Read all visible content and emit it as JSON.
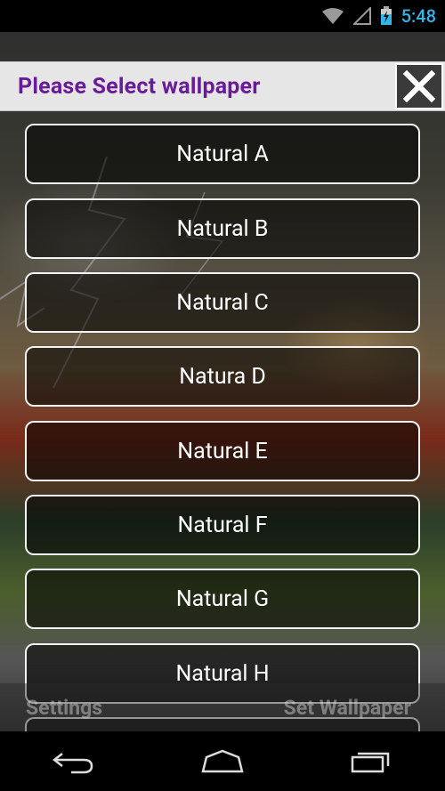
{
  "status_bar": {
    "time": "5:48",
    "icons": [
      "wifi-icon",
      "signal-icon",
      "battery-icon"
    ]
  },
  "dialog": {
    "title": "Please Select wallpaper",
    "close_icon": "close-icon"
  },
  "wallpapers": [
    {
      "label": "Natural A"
    },
    {
      "label": "Natural B"
    },
    {
      "label": "Natural C"
    },
    {
      "label": "Natura D"
    },
    {
      "label": "Natural E"
    },
    {
      "label": "Natural F"
    },
    {
      "label": "Natural G"
    },
    {
      "label": "Natural H"
    }
  ],
  "bottom_bar": {
    "settings_label": "Settings",
    "set_wallpaper_label": "Set Wallpaper"
  },
  "nav_bar": {
    "icons": [
      "back-icon",
      "home-icon",
      "recents-icon"
    ]
  },
  "colors": {
    "title_text": "#6a1b9a",
    "status_time": "#33b5e5"
  }
}
